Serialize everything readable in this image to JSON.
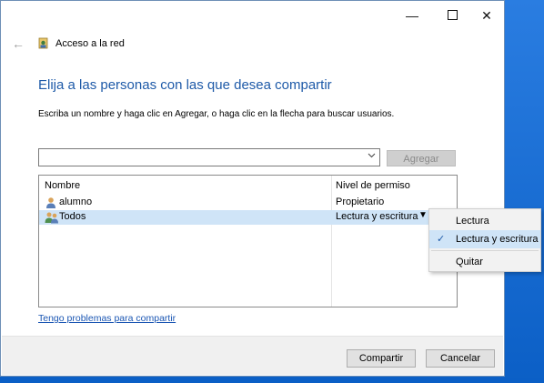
{
  "window": {
    "nav_title": "Acceso a la red",
    "controls": {
      "minimize": "—",
      "close": "✕"
    }
  },
  "main": {
    "heading": "Elija a las personas con las que desea compartir",
    "instructions": "Escriba un nombre y haga clic en Agregar, o haga clic en la flecha para buscar usuarios.",
    "add_button": "Agregar",
    "combo_value": ""
  },
  "list": {
    "headers": {
      "name": "Nombre",
      "permission": "Nivel de permiso"
    },
    "rows": [
      {
        "name": "alumno",
        "permission": "Propietario"
      },
      {
        "name": "Todos",
        "permission": "Lectura y escritura"
      }
    ],
    "dropdown_glyph": "▼"
  },
  "menu": {
    "items": [
      {
        "label": "Lectura",
        "checked": false
      },
      {
        "label": "Lectura y escritura",
        "checked": true
      },
      {
        "label": "Quitar",
        "checked": false
      }
    ],
    "check_glyph": "✓"
  },
  "help_link": "Tengo problemas para compartir",
  "footer": {
    "share": "Compartir",
    "cancel": "Cancelar"
  },
  "colors": {
    "heading": "#1e5aa8",
    "selection": "#cfe4f7",
    "link": "#1a56b3"
  }
}
